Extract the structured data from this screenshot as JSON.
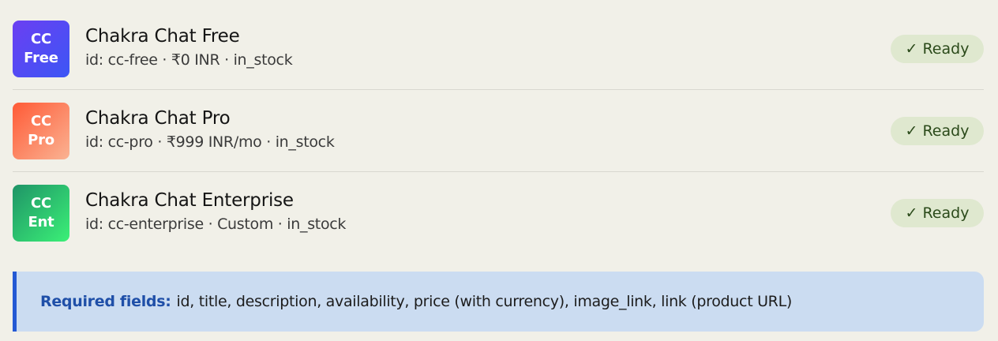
{
  "products": [
    {
      "logo_top": "CC",
      "logo_bottom": "Free",
      "title": "Chakra Chat Free",
      "meta": "id: cc-free · ₹0 INR · in_stock",
      "status": "Ready",
      "status_icon": "✓"
    },
    {
      "logo_top": "CC",
      "logo_bottom": "Pro",
      "title": "Chakra Chat Pro",
      "meta": "id: cc-pro · ₹999 INR/mo · in_stock",
      "status": "Ready",
      "status_icon": "✓"
    },
    {
      "logo_top": "CC",
      "logo_bottom": "Ent",
      "title": "Chakra Chat Enterprise",
      "meta": "id: cc-enterprise · Custom · in_stock",
      "status": "Ready",
      "status_icon": "✓"
    }
  ],
  "info": {
    "label": "Required fields:",
    "text": "id, title, description, availability, price (with currency), image_link, link (product URL)"
  },
  "colors": {
    "background": "#f1f0e8",
    "badge_bg": "#dfe8cf",
    "info_bg": "#cbdcf1",
    "info_accent": "#2459d4"
  }
}
